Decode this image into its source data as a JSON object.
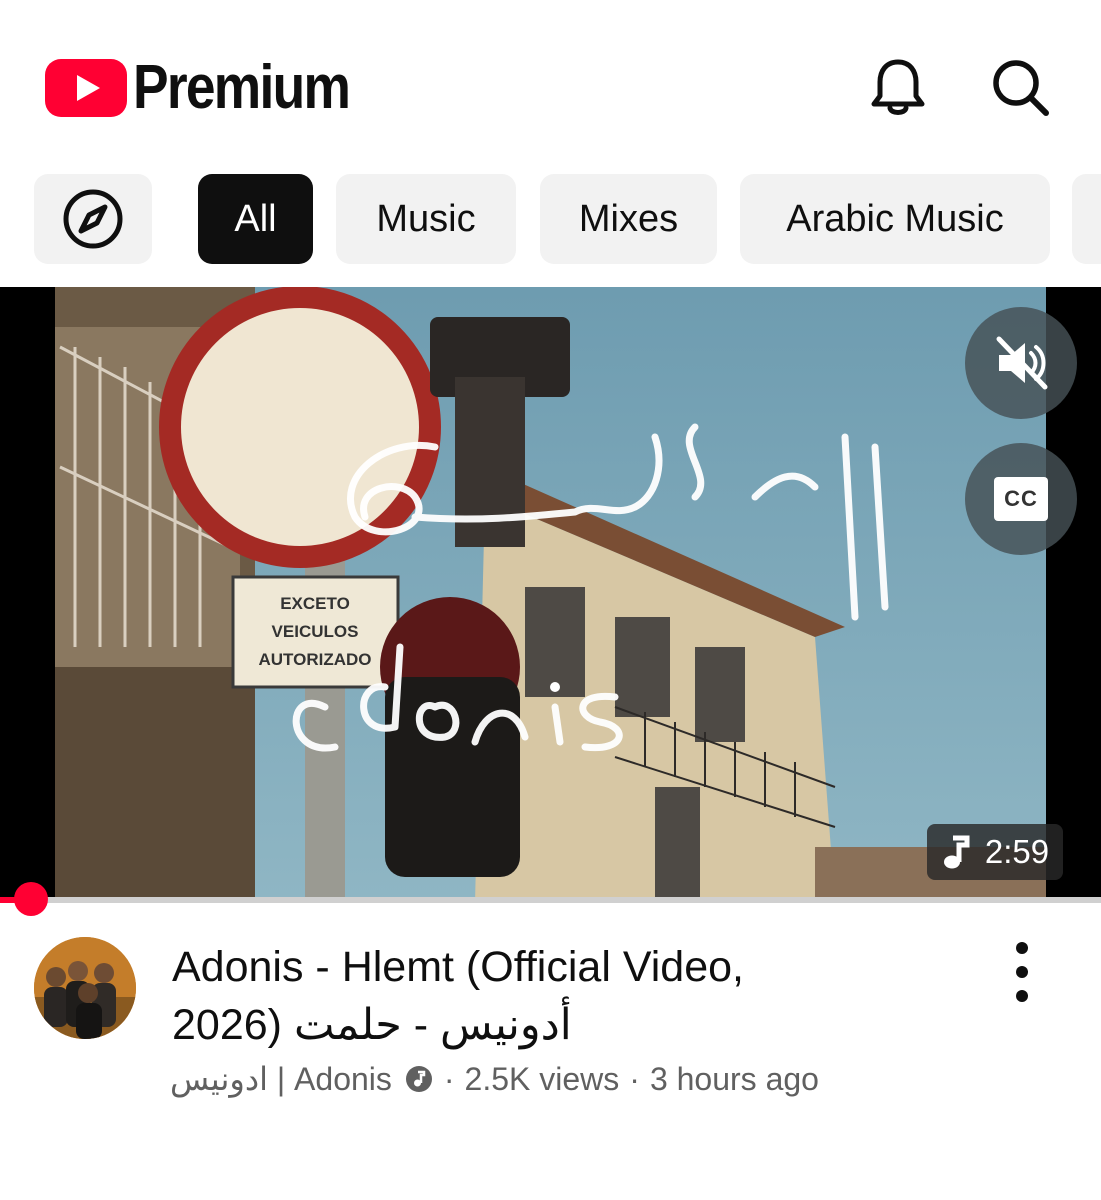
{
  "header": {
    "brand": "Premium",
    "icons": [
      "youtube-logo-icon",
      "bell-icon",
      "search-icon"
    ]
  },
  "chips": {
    "explore_icon": "compass-icon",
    "items": [
      {
        "label": "All",
        "active": true
      },
      {
        "label": "Music",
        "active": false
      },
      {
        "label": "Mixes",
        "active": false
      },
      {
        "label": "Arabic Music",
        "active": false
      }
    ]
  },
  "video": {
    "overlay_arabic": "أدونيس",
    "overlay_latin": "adonis",
    "sign_text": [
      "EXCETO",
      "VEICULOS",
      "AUTORIZADO"
    ],
    "mute_icon": "volume-off-icon",
    "cc_label": "CC",
    "duration": "2:59",
    "duration_icon": "music-note-icon",
    "progress": 0.03
  },
  "meta": {
    "title_line1": "Adonis - Hlemt (Official Video,",
    "title_line2": "2026) أدونيس - حلمت",
    "channel": "ادونيس | Adonis",
    "verified_icon": "music-verified-icon",
    "views": "2.5K views",
    "age": "3 hours ago"
  },
  "colors": {
    "brand_red": "#ff0033",
    "chip_bg": "#f2f2f2",
    "chip_active_bg": "#0f0f0f",
    "secondary_text": "#606060"
  }
}
